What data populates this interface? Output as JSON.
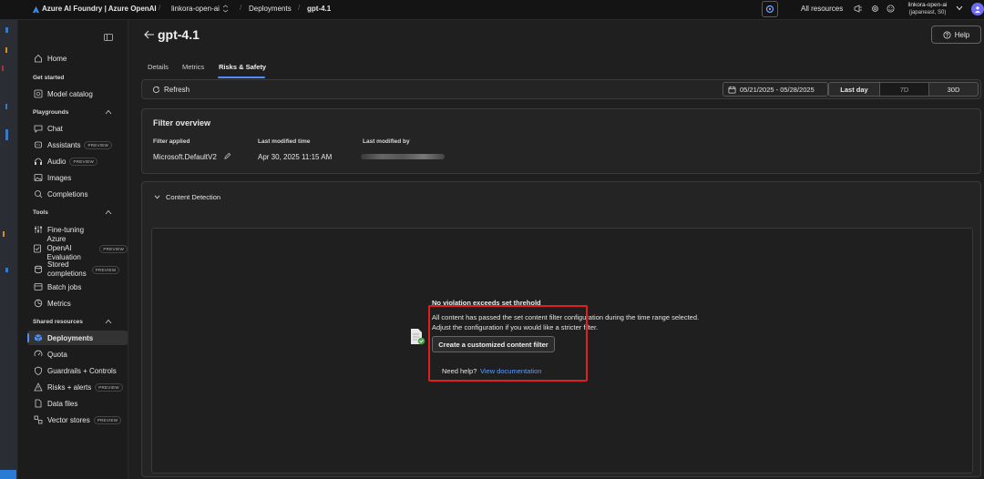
{
  "topbar": {
    "brand": "Azure AI Foundry | Azure OpenAI",
    "project": "linkora-open-ai",
    "deployments": "Deployments",
    "model": "gpt-4.1",
    "all_resources": "All resources",
    "account_name": "linkora-open-ai",
    "account_region": "(japaneast, S0)"
  },
  "sidebar": {
    "home": "Home",
    "get_started": "Get started",
    "model_catalog": "Model catalog",
    "playgrounds": "Playgrounds",
    "chat": "Chat",
    "assistants": "Assistants",
    "audio": "Audio",
    "images": "Images",
    "completions": "Completions",
    "tools": "Tools",
    "fine_tuning": "Fine-tuning",
    "aoai_eval_1": "Azure OpenAI",
    "aoai_eval_2": "Evaluation",
    "stored_1": "Stored",
    "stored_2": "completions",
    "batch_jobs": "Batch jobs",
    "metrics": "Metrics",
    "shared_resources": "Shared resources",
    "deployments": "Deployments",
    "quota": "Quota",
    "guardrails": "Guardrails + Controls",
    "risks_alerts": "Risks + alerts",
    "data_files": "Data files",
    "vector_stores": "Vector stores",
    "preview": "PREVIEW"
  },
  "page": {
    "title": "gpt-4.1",
    "help": "Help",
    "tabs": [
      "Details",
      "Metrics",
      "Risks & Safety"
    ],
    "refresh": "Refresh",
    "date_range": "05/21/2025 - 05/28/2025",
    "ranges": [
      "Last day",
      "7D",
      "30D"
    ]
  },
  "filter_overview": {
    "title": "Filter overview",
    "col1_label": "Filter applied",
    "col1_value": "Microsoft.DefaultV2",
    "col2_label": "Last modified time",
    "col2_value": "Apr 30, 2025 11:15 AM",
    "col3_label": "Last modified by"
  },
  "content_detection": {
    "title": "Content Detection",
    "heading": "No violation exceeds set threhold",
    "line1": "All content has passed the set content filter configuration during the time range selected.",
    "line2": "Adjust the configuration if you would like a stricter filter.",
    "button": "Create a customized content filter",
    "help_prefix": "Need help?",
    "help_link": "View documentation"
  },
  "colors": {
    "accent": "#4f8ef7",
    "link": "#5b9cf5",
    "highlight_box": "#e02020",
    "avatar": "#6f6cf0"
  }
}
